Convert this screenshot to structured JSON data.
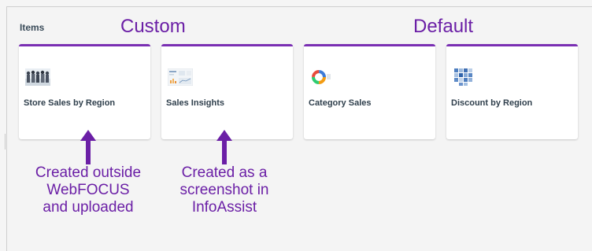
{
  "section": {
    "label": "Items"
  },
  "annotations": {
    "custom": "Custom",
    "default": "Default",
    "note_left": "Created outside\nWebFOCUS\nand uploaded",
    "note_right": "Created as a\nscreenshot in\nInfoAssist",
    "color": "#6b1fa6"
  },
  "cards": [
    {
      "title": "Store Sales by Region",
      "icon": "people-photo-thumbnail"
    },
    {
      "title": "Sales Insights",
      "icon": "dashboard-screenshot-thumbnail"
    },
    {
      "title": "Category Sales",
      "icon": "ring-chart-icon"
    },
    {
      "title": "Discount by Region",
      "icon": "heatmap-grid-icon"
    }
  ],
  "accent_color": "#7a2fb3"
}
